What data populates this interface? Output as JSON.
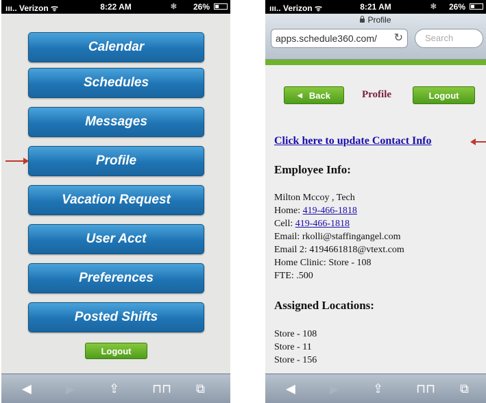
{
  "left_phone": {
    "status": {
      "carrier": "Verizon",
      "time": "8:22 AM",
      "battery": "26%"
    },
    "menu": [
      {
        "label": "Calendar"
      },
      {
        "label": "Schedules"
      },
      {
        "label": "Messages"
      },
      {
        "label": "Profile"
      },
      {
        "label": "Vacation Request"
      },
      {
        "label": "User Acct"
      },
      {
        "label": "Preferences"
      },
      {
        "label": "Posted Shifts"
      }
    ],
    "logout_label": "Logout"
  },
  "right_phone": {
    "status": {
      "carrier": "Verizon",
      "time": "8:21 AM",
      "battery": "26%"
    },
    "page_title": "Profile",
    "url": "apps.schedule360.com/",
    "search_placeholder": "Search",
    "back_label": "Back",
    "profile_label": "Profile",
    "logout_label": "Logout",
    "contact_link": "Click here to update Contact Info",
    "employee_heading": "Employee Info:",
    "employee": {
      "name": "Milton Mccoy , Tech",
      "home_label": "Home: ",
      "home_phone": "419-466-1818",
      "cell_label": "Cell: ",
      "cell_phone": "419-466-1818",
      "email": "Email: rkolli@staffingangel.com",
      "email2": "Email 2: 4194661818@vtext.com",
      "home_clinic": "Home Clinic: Store - 108",
      "fte": "FTE: .500"
    },
    "locations_heading": "Assigned Locations:",
    "locations": [
      "Store - 108",
      "Store - 11",
      "Store - 156"
    ]
  }
}
